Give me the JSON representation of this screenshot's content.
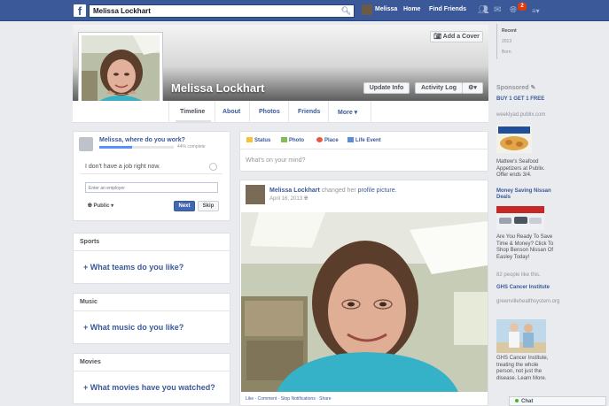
{
  "topbar": {
    "logo": "f",
    "search_value": "Melissa Lockhart",
    "nav_user": "Melissa",
    "nav_home": "Home",
    "nav_find_friends": "Find Friends",
    "notification_count": "2"
  },
  "cover": {
    "add_cover_label": "Add a Cover",
    "name": "Melissa Lockhart",
    "update_info_label": "Update Info",
    "activity_log_label": "Activity Log"
  },
  "tabs": [
    {
      "label": "Timeline"
    },
    {
      "label": "About"
    },
    {
      "label": "Photos"
    },
    {
      "label": "Friends"
    },
    {
      "label": "More ▾"
    }
  ],
  "work": {
    "question": "Melissa, where do you work?",
    "progress_percent": 44,
    "progress_label": "44% complete",
    "no_job_label": "I don't have a job right now.",
    "employer_placeholder": "Enter an employer",
    "privacy_label": "Public ▾",
    "next_label": "Next",
    "skip_label": "Skip"
  },
  "sections": [
    {
      "title": "Sports",
      "prompt": "What teams do you like?"
    },
    {
      "title": "Music",
      "prompt": "What music do you like?"
    },
    {
      "title": "Movies",
      "prompt": "What movies have you watched?"
    }
  ],
  "composer": {
    "status": "Status",
    "photo": "Photo",
    "place": "Place",
    "life_event": "Life Event",
    "placeholder": "What's on your mind?"
  },
  "post": {
    "author": "Melissa Lockhart",
    "action": "changed her",
    "object": "profile picture.",
    "date": "April 16, 2013",
    "like": "Like",
    "comment": "Comment",
    "stop_notifications": "Stop Notifications",
    "share": "Share"
  },
  "sidebar": {
    "recent": "Recent",
    "year": "2013",
    "born": "Born",
    "sponsored": "Sponsored",
    "ads": [
      {
        "title": "BUY 1 GET 1 FREE",
        "url": "weeklyad.publix.com"
      },
      {
        "text": "Mattew's Seafood Appetizers at Publix. Offer ends 3/4."
      },
      {
        "title": "Money Saving Nissan Deals",
        "text": "Are You Ready To Save Time & Money? Click To Shop Benson Nissan Of Easley Today!",
        "likes": "82 people like this."
      },
      {
        "title": "GHS Cancer Institute",
        "url": "greenvillehealthsystem.org",
        "text": "GHS Cancer Institute, treating the whole person, not just the disease. Learn More."
      }
    ],
    "chat": "Chat"
  }
}
